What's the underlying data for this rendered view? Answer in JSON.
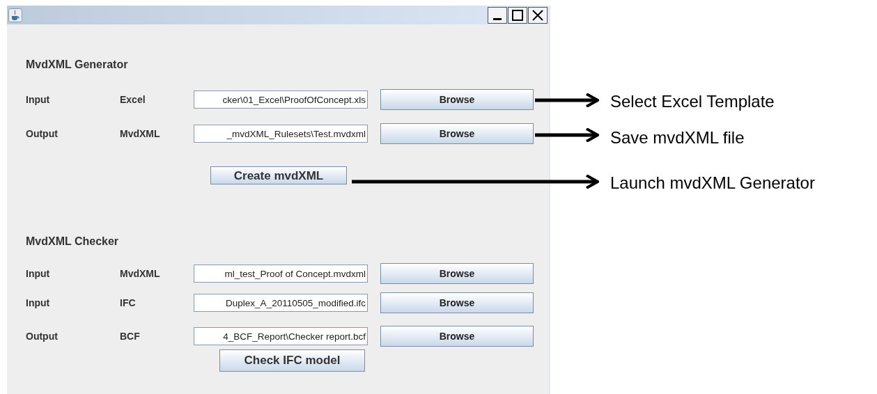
{
  "sections": [
    {
      "heading": "MvdXML Generator",
      "rows": [
        {
          "direction": "Input",
          "format": "Excel",
          "path": "cker\\01_Excel\\ProofOfConcept.xls",
          "button": "Browse"
        },
        {
          "direction": "Output",
          "format": "MvdXML",
          "path": "_mvdXML_Rulesets\\Test.mvdxml",
          "button": "Browse"
        }
      ],
      "action": "Create mvdXML"
    },
    {
      "heading": "MvdXML Checker",
      "rows": [
        {
          "direction": "Input",
          "format": "MvdXML",
          "path": "ml_test_Proof of Concept.mvdxml",
          "button": "Browse"
        },
        {
          "direction": "Input",
          "format": "IFC",
          "path": "Duplex_A_20110505_modified.ifc",
          "button": "Browse"
        },
        {
          "direction": "Output",
          "format": "BCF",
          "path": "4_BCF_Report\\Checker report.bcf",
          "button": "Browse"
        }
      ],
      "action": "Check IFC model"
    }
  ],
  "annotations": [
    "Select Excel Template",
    "Save mvdXML file",
    "Launch mvdXML Generator"
  ]
}
